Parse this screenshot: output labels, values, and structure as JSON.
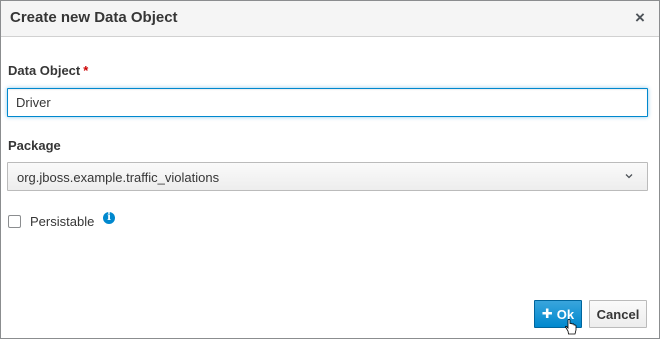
{
  "dialog": {
    "title": "Create new Data Object",
    "close_icon": "close-icon"
  },
  "form": {
    "data_object_label": "Data Object",
    "required_marker": "*",
    "data_object_value": "Driver",
    "package_label": "Package",
    "package_value": "org.jboss.example.traffic_violations",
    "persistable_label": "Persistable",
    "persistable_checked": false
  },
  "buttons": {
    "ok_label": "Ok",
    "cancel_label": "Cancel"
  },
  "colors": {
    "primary": "#0088ce",
    "required": "#cc0000"
  }
}
